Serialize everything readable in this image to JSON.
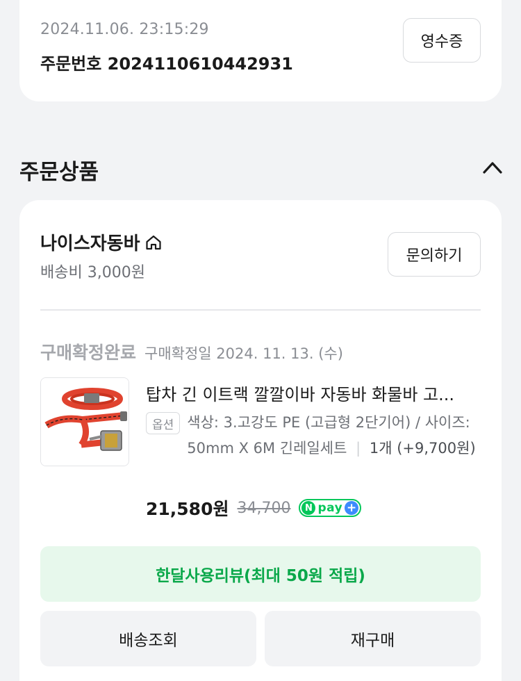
{
  "order": {
    "datetime": "2024.11.06. 23:15:29",
    "number_label": "주문번호 2024110610442931",
    "receipt_label": "영수증"
  },
  "section": {
    "title": "주문상품",
    "toggle_icon": "chevron-up-icon"
  },
  "seller": {
    "name": "나이스자동바",
    "icon": "home-icon",
    "shipping_fee": "배송비 3,000원",
    "inquiry_label": "문의하기"
  },
  "item": {
    "status": "구매확정완료",
    "status_date": "구매확정일 2024. 11. 13. (수)",
    "title": "탑차 긴 이트랙 깔깔이바 자동바 화물바 고...",
    "option_badge": "옵션",
    "option_text": "색상: 3.고강도 PE (고급형 2단기어) / 사이즈: 50mm X 6M 긴레일세트",
    "option_separator": "|",
    "quantity": "1개 (+9,700원)",
    "price": "21,580원",
    "original_price": "34,700",
    "npay_n": "N",
    "npay_text": "pay",
    "npay_plus": "+"
  },
  "actions": {
    "review_label": "한달사용리뷰(최대 50원 적립)",
    "track_label": "배송조회",
    "rebuy_label": "재구매"
  },
  "colors": {
    "page_bg": "#f2f3f5",
    "card_bg": "#ffffff",
    "review_bg": "#e7f8ec",
    "review_text": "#0aa84a",
    "npay_green": "#03c75a",
    "npay_blue": "#3d8bfd",
    "strap_red": "#e0432f"
  }
}
